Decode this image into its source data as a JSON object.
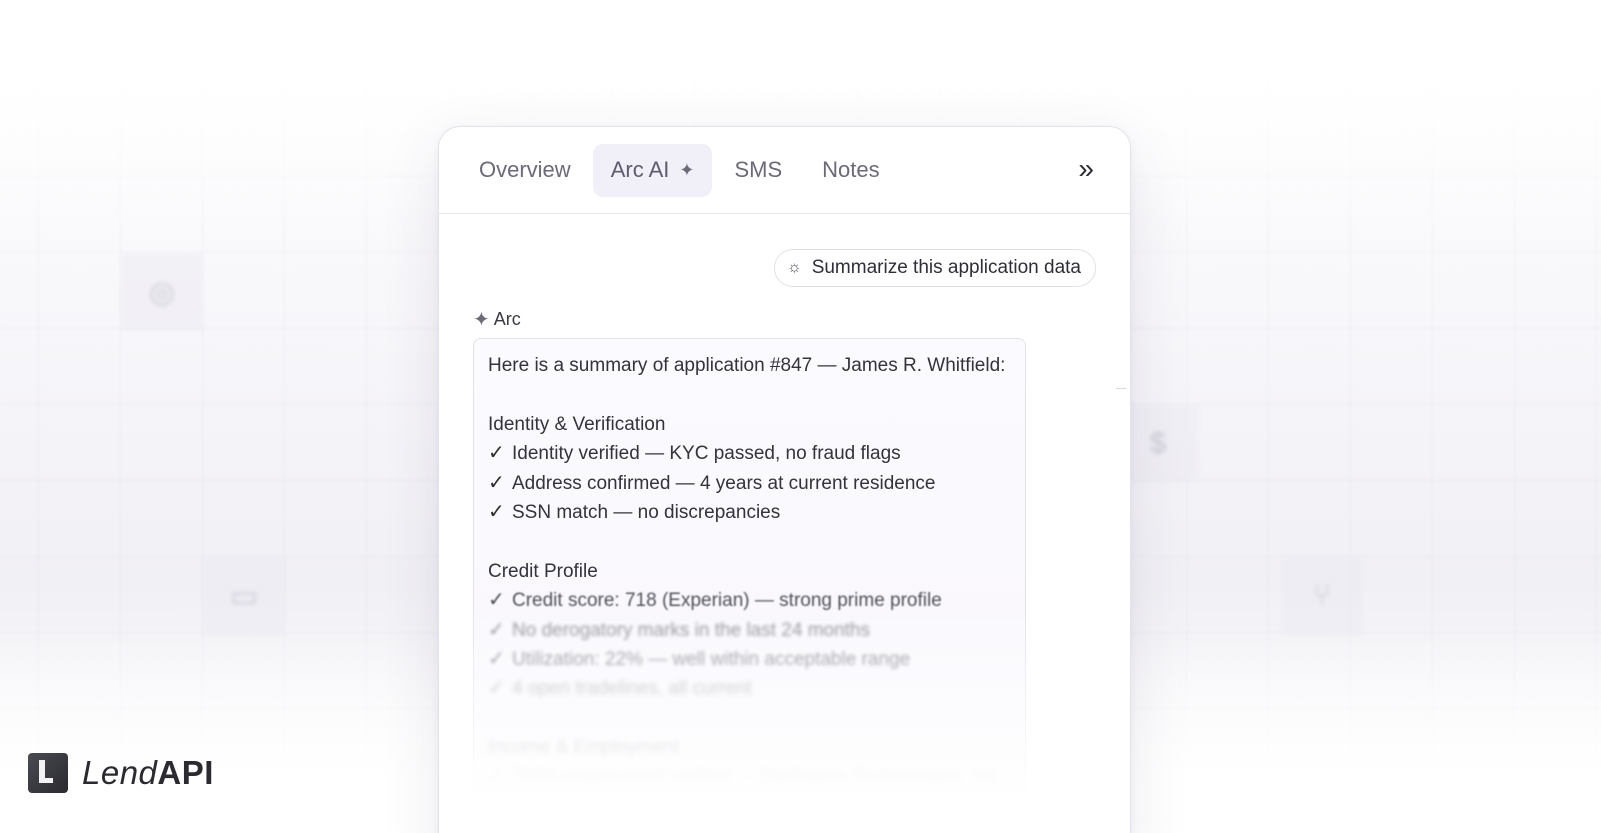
{
  "tabs": [
    {
      "label": "Overview",
      "active": false
    },
    {
      "label": "Arc AI",
      "active": true,
      "icon": "sparkle-icon"
    },
    {
      "label": "SMS",
      "active": false
    },
    {
      "label": "Notes",
      "active": false
    }
  ],
  "expand_icon": "»",
  "prompt_chip": {
    "icon": "lightbulb-icon",
    "label": "Summarize this application data"
  },
  "assistant": {
    "icon": "sparkle-icon",
    "name": "Arc"
  },
  "message": {
    "intro": "Here is a summary of application #847 — James R. Whitfield:",
    "sections": [
      {
        "heading": "Identity & Verification",
        "items": [
          "Identity verified — KYC passed, no fraud flags",
          "Address confirmed — 4 years at current residence",
          "SSN match — no discrepancies"
        ]
      },
      {
        "heading": "Credit Profile",
        "items": [
          "Credit score: 718 (Experian) — strong prime profile",
          "No derogatory marks in the last 24 months",
          "Utilization: 22% — well within acceptable range",
          "4 open tradelines, all current"
        ]
      },
      {
        "heading": "Income & Employment",
        "items": [
          "TWN employment verified — Darlington Technologies, Inc."
        ]
      }
    ]
  },
  "brand": {
    "part1": "Lend",
    "part2": "API"
  },
  "colors": {
    "active_tab_bg": "#f1eff8",
    "text": "#2b2b33",
    "muted": "#6b6a78"
  }
}
